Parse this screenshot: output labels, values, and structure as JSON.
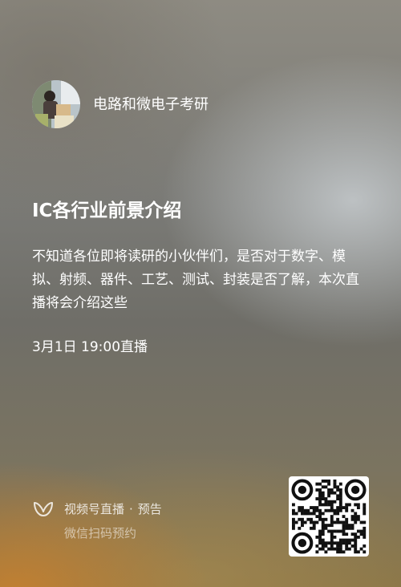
{
  "account": {
    "name": "电路和微电子考研",
    "avatar_icon": "profile-photo"
  },
  "post": {
    "title": "IC各行业前景介绍",
    "description": "不知道各位即将读研的小伙伴们，是否对于数字、模拟、射频、器件、工艺、测试、封装是否了解，本次直播将会介绍这些",
    "schedule": "3月1日 19:00直播"
  },
  "footer": {
    "channel_icon": "channels-butterfly-icon",
    "channel_label": "视频号直播",
    "separator": "·",
    "preview_label": "预告",
    "hint": "微信扫码预约"
  },
  "qr": {
    "icon": "qr-code"
  },
  "colors": {
    "text": "#ffffff",
    "background_top": "#8e8b82",
    "background_bottom_left": "#c48030",
    "footer_text": "#d6d4cf"
  }
}
